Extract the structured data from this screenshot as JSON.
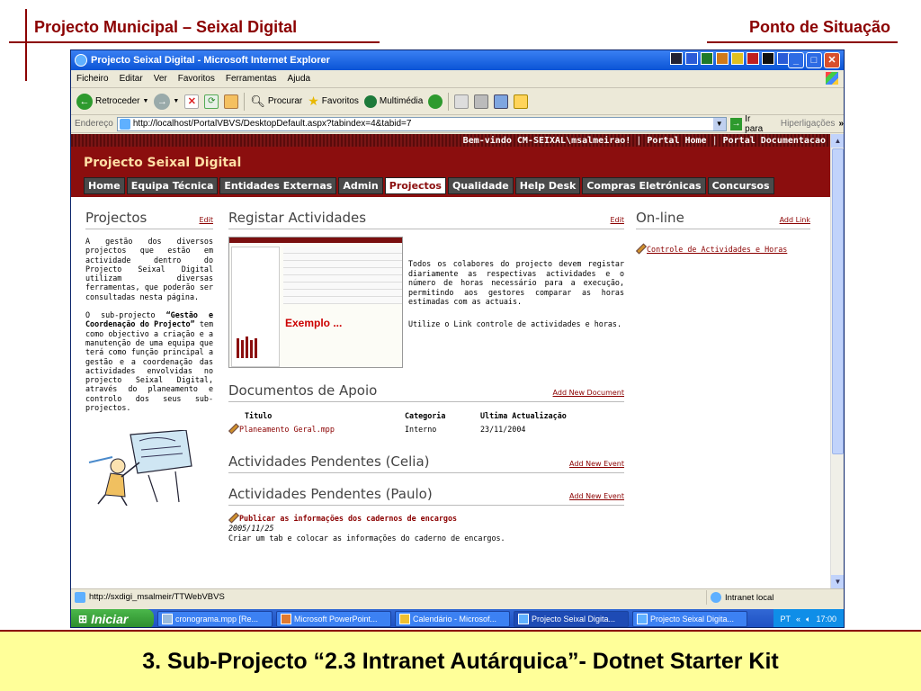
{
  "slide": {
    "title_left": "Projecto Municipal – Seixal Digital",
    "title_right": "Ponto de Situação",
    "footer": "3. Sub-Projecto “2.3 Intranet Autárquica”- Dotnet Starter Kit"
  },
  "window": {
    "title": "Projecto Seixal Digital - Microsoft Internet Explorer"
  },
  "menu": [
    "Ficheiro",
    "Editar",
    "Ver",
    "Favoritos",
    "Ferramentas",
    "Ajuda"
  ],
  "toolbar": {
    "back": "Retroceder",
    "search": "Procurar",
    "favorites": "Favoritos",
    "media": "Multimédia"
  },
  "address": {
    "label": "Endereço",
    "url": "http://localhost/PortalVBVS/DesktopDefault.aspx?tabindex=4&tabid=7",
    "go": "Ir para",
    "links": "Hiperligações"
  },
  "portal": {
    "welcome": "Bem-vindo CM-SEIXAL\\msalmeirao!",
    "home_link": "Portal Home",
    "docs_link": "Portal Documentacao",
    "title": "Projecto Seixal Digital",
    "tabs": [
      "Home",
      "Equipa Técnica",
      "Entidades Externas",
      "Admin",
      "Projectos",
      "Qualidade",
      "Help Desk",
      "Compras Eletrónicas",
      "Concursos"
    ]
  },
  "projectos": {
    "title": "Projectos",
    "edit": "Edit",
    "para1": "A gestão dos diversos projectos que estão em actividade dentro do Projecto Seixal Digital utilizam diversas ferramentas, que poderão ser consultadas nesta página.",
    "para2_pre": "O sub-projecto ",
    "para2_bold": "“Gestão e Coordenação do Projecto”",
    "para2_post": " tem como objectivo a criação e a manutenção de uma equipa que terá como função principal a gestão e a coordenação das actividades envolvidas no projecto Seixal Digital, através do planeamento e controlo dos seus sub-projectos."
  },
  "registar": {
    "title": "Registar Actividades",
    "edit": "Edit",
    "exemplo": "Exemplo ...",
    "para1": "Todos os colabores do projecto devem registar diariamente as respectivas actividades e o número de horas necessário para a execução, permitindo aos gestores comparar as horas estimadas com as actuais.",
    "para2": "Utilize o Link controle de actividades e horas."
  },
  "documentos": {
    "title": "Documentos de Apoio",
    "add": "Add New Document",
    "headers": [
      "Titulo",
      "Categoria",
      "Ultima Actualização"
    ],
    "rows": [
      [
        "Planeamento Geral.mpp",
        "Interno",
        "23/11/2004"
      ]
    ]
  },
  "celia": {
    "title": "Actividades Pendentes (Celia)",
    "add": "Add New Event"
  },
  "paulo": {
    "title": "Actividades Pendentes (Paulo)",
    "add": "Add New Event",
    "event_title": "Publicar as informações dos cadernos de encargos",
    "event_date": "2005/11/25",
    "event_desc": "Criar um tab e colocar as informações do caderno de encargos."
  },
  "online": {
    "title": "On-line",
    "add": "Add Link",
    "link": "Controle de Actividades e Horas"
  },
  "status": {
    "url": "http://sxdigi_msalmeir/TTWebVBVS",
    "zone": "Intranet local"
  },
  "taskbar": {
    "start": "Iniciar",
    "tasks": [
      "cronograma.mpp [Re...",
      "Microsoft PowerPoint...",
      "Calendário - Microsof...",
      "Projecto Seixal Digita...",
      "Projecto Seixal Digita..."
    ],
    "lang": "PT",
    "clock": "17:00"
  }
}
